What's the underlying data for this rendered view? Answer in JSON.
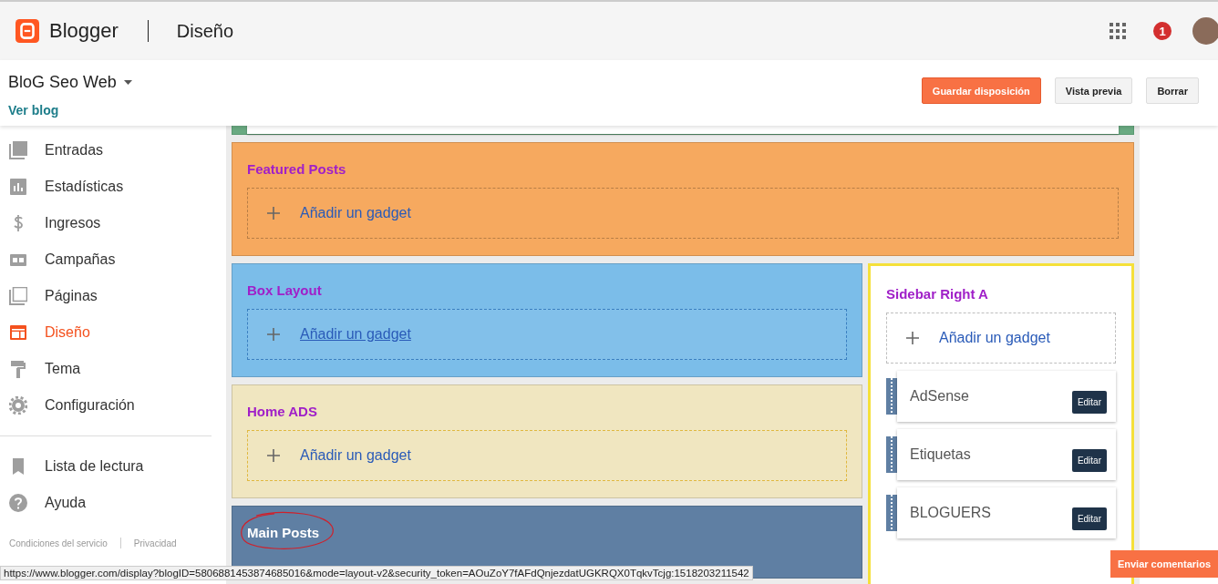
{
  "header": {
    "logo": "Blogger",
    "section": "Diseño",
    "notifications": "1"
  },
  "blog": {
    "name": "BloG Seo Web",
    "view_link": "Ver blog"
  },
  "actions": [
    {
      "label": "Guardar disposición",
      "kind": "primary"
    },
    {
      "label": "Vista previa",
      "kind": "default"
    },
    {
      "label": "Borrar",
      "kind": "default"
    }
  ],
  "nav": [
    {
      "label": "Entradas",
      "kind": "posts",
      "selected": false
    },
    {
      "label": "Estadísticas",
      "kind": "stats",
      "selected": false
    },
    {
      "label": "Ingresos",
      "kind": "dollar",
      "selected": false
    },
    {
      "label": "Campañas",
      "kind": "ad",
      "selected": false
    },
    {
      "label": "Páginas",
      "kind": "pages",
      "selected": false
    },
    {
      "label": "Diseño",
      "kind": "layout",
      "selected": true
    },
    {
      "label": "Tema",
      "kind": "roller",
      "selected": false
    },
    {
      "label": "Configuración",
      "kind": "gear",
      "selected": false
    }
  ],
  "nav_secondary": [
    {
      "label": "Lista de lectura",
      "kind": "bookmark",
      "selected": false
    },
    {
      "label": "Ayuda",
      "kind": "help",
      "selected": false
    }
  ],
  "footer_links": [
    "Condiciones del servicio",
    "Privacidad"
  ],
  "top_section": {
    "color": "#6aaa82"
  },
  "full_sections": [
    {
      "title": "Featured Posts",
      "add_gadget": "Añadir un gadget",
      "color": "#f6a95f",
      "hovered": false
    }
  ],
  "left_sections": [
    {
      "title": "Box Layout",
      "add_gadget": "Añadir un gadget",
      "color": "#7bbde9",
      "hovered": true,
      "circled": false
    },
    {
      "title": "Home ADS",
      "add_gadget": "Añadir un gadget",
      "color": "#f0e6c0",
      "hovered": false,
      "circled": false
    },
    {
      "title": "Main Posts",
      "color": "#5f7fa3",
      "circled": true
    }
  ],
  "sidebar_section": {
    "title": "Sidebar Right A",
    "add_gadget": "Añadir un gadget",
    "widgets": [
      {
        "name": "AdSense",
        "edit": "Editar"
      },
      {
        "name": "Etiquetas",
        "edit": "Editar"
      },
      {
        "name": "BLOGUERS",
        "edit": "Editar"
      }
    ]
  },
  "status_url": "https://www.blogger.com/display?blogID=5806881453874685016&mode=layout-v2&security_token=AOuZoY7fAFdQnjezdatUGKRQX0TqkvTcjg:1518203211542",
  "feedback_button": "Enviar comentarios"
}
